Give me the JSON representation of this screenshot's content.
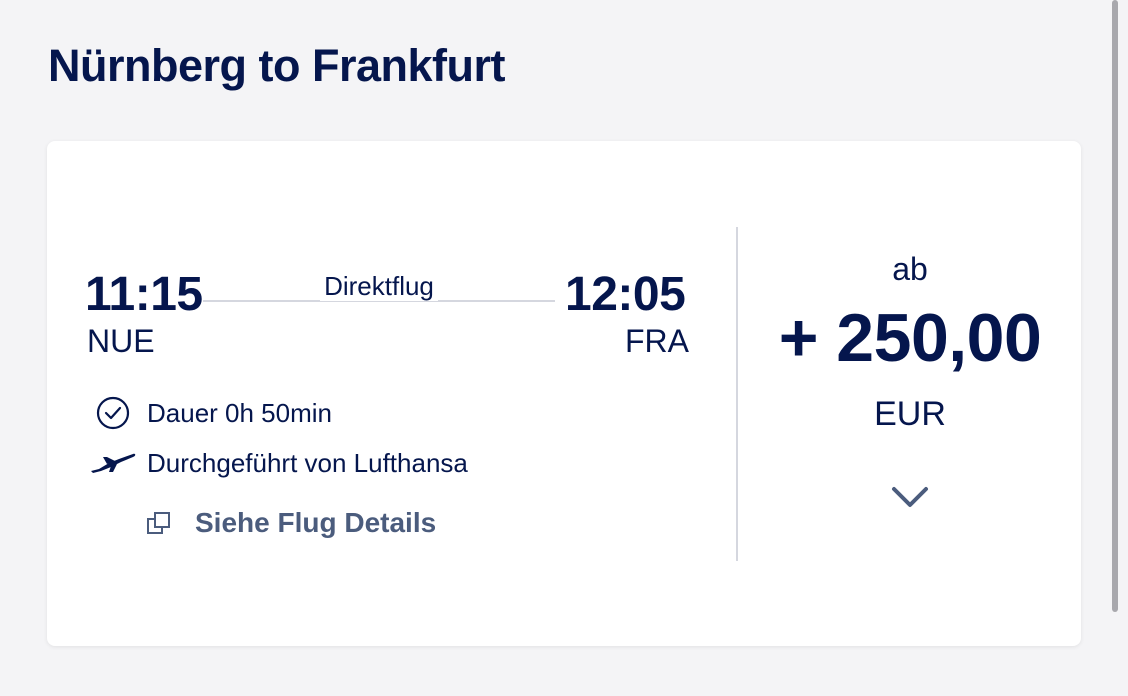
{
  "header": {
    "title": "Nürnberg to Frankfurt"
  },
  "flight": {
    "departure_time": "11:15",
    "departure_code": "NUE",
    "arrival_time": "12:05",
    "arrival_code": "FRA",
    "route_type": "Direktflug",
    "duration": "Dauer 0h 50min",
    "operator": "Durchgeführt von Lufthansa",
    "details_link": "Siehe Flug Details"
  },
  "price": {
    "from_label": "ab",
    "amount": "+ 250,00",
    "currency": "EUR"
  },
  "icons": {
    "duration": "clock-icon",
    "operator": "airplane-icon",
    "details": "external-window-icon",
    "expand": "chevron-down-icon"
  },
  "colors": {
    "brand_navy": "#05164d",
    "link_gray": "#4b5c7d",
    "divider": "#d5d7df"
  }
}
